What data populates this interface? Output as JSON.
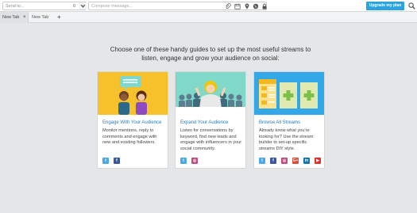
{
  "topbar": {
    "send_to_placeholder": "Send to...",
    "send_to_count": "0",
    "compose_placeholder": "Compose message...",
    "upgrade_label": "Upgrade my plan"
  },
  "tabs": {
    "items": [
      {
        "label": "New Tab",
        "close": "×"
      },
      {
        "label": "New Tab"
      }
    ],
    "add_label": "+"
  },
  "main": {
    "heading_line1": "Choose one of these handy guides to set up the most useful streams to",
    "heading_line2": "listen, engage and grow your audience on social:"
  },
  "cards": [
    {
      "title": "Engage With Your Audience",
      "description": "Monitor mentions, reply to comments and engage with new and existing followers.",
      "art_color": "#f7c12c",
      "socials": [
        {
          "icon": "twitter-icon",
          "glyph": "t",
          "color": "#4aa9e6"
        },
        {
          "icon": "facebook-icon",
          "glyph": "f",
          "color": "#3b5998"
        }
      ]
    },
    {
      "title": "Expand Your Audience",
      "description": "Listen for conversations by keyword, find new leads and engage with influencers in your social community.",
      "art_color": "#7fd8c8",
      "socials": [
        {
          "icon": "twitter-icon",
          "glyph": "t",
          "color": "#4aa9e6"
        },
        {
          "icon": "instagram-icon",
          "glyph": "◎",
          "color": "#c04b7e"
        }
      ]
    },
    {
      "title": "Browse All Streams",
      "description": "Already know what you're looking for? Use the stream builder to set-up specific streams DIY style.",
      "art_color": "#33a8e8",
      "socials": [
        {
          "icon": "twitter-icon",
          "glyph": "t",
          "color": "#4aa9e6"
        },
        {
          "icon": "facebook-icon",
          "glyph": "f",
          "color": "#3b5998"
        },
        {
          "icon": "instagram-icon",
          "glyph": "◎",
          "color": "#c04b7e"
        },
        {
          "icon": "google-plus-icon",
          "glyph": "G+",
          "color": "#dd4b39"
        },
        {
          "icon": "linkedin-icon",
          "glyph": "in",
          "color": "#0e76a8"
        },
        {
          "icon": "youtube-icon",
          "glyph": "▶",
          "color": "#e52d27"
        }
      ]
    }
  ]
}
